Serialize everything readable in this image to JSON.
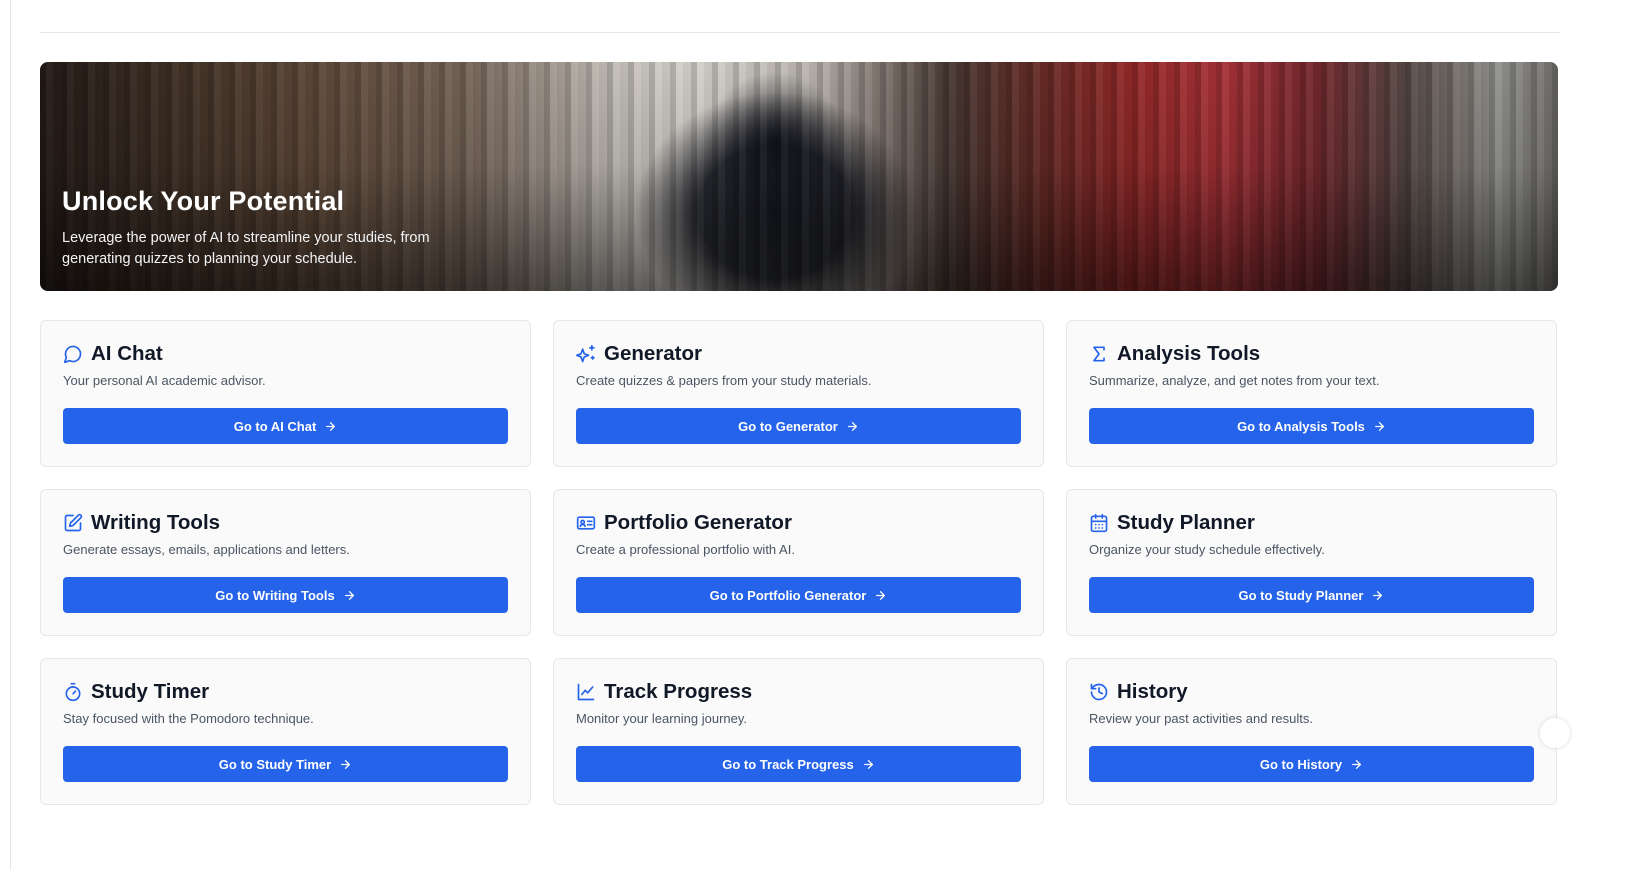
{
  "colors": {
    "accent": "#2563eb",
    "card_bg": "#fafafa",
    "border": "#e5e7eb",
    "title": "#111827",
    "description": "#4b5563"
  },
  "hero": {
    "title": "Unlock Your Potential",
    "subtitle": "Leverage the power of AI to streamline your studies, from generating quizzes to planning your schedule."
  },
  "cards": [
    {
      "icon": "chat-bubble-icon",
      "title": "AI Chat",
      "description": "Your personal AI academic advisor.",
      "button": "Go to AI Chat"
    },
    {
      "icon": "sparkles-icon",
      "title": "Generator",
      "description": "Create quizzes & papers from your study materials.",
      "button": "Go to Generator"
    },
    {
      "icon": "sigma-icon",
      "title": "Analysis Tools",
      "description": "Summarize, analyze, and get notes from your text.",
      "button": "Go to Analysis Tools"
    },
    {
      "icon": "edit-square-icon",
      "title": "Writing Tools",
      "description": "Generate essays, emails, applications and letters.",
      "button": "Go to Writing Tools"
    },
    {
      "icon": "id-card-icon",
      "title": "Portfolio Generator",
      "description": "Create a professional portfolio with AI.",
      "button": "Go to Portfolio Generator"
    },
    {
      "icon": "calendar-icon",
      "title": "Study Planner",
      "description": "Organize your study schedule effectively.",
      "button": "Go to Study Planner"
    },
    {
      "icon": "stopwatch-icon",
      "title": "Study Timer",
      "description": "Stay focused with the Pomodoro technique.",
      "button": "Go to Study Timer"
    },
    {
      "icon": "line-chart-icon",
      "title": "Track Progress",
      "description": "Monitor your learning journey.",
      "button": "Go to Track Progress"
    },
    {
      "icon": "history-icon",
      "title": "History",
      "description": "Review your past activities and results.",
      "button": "Go to History"
    }
  ]
}
